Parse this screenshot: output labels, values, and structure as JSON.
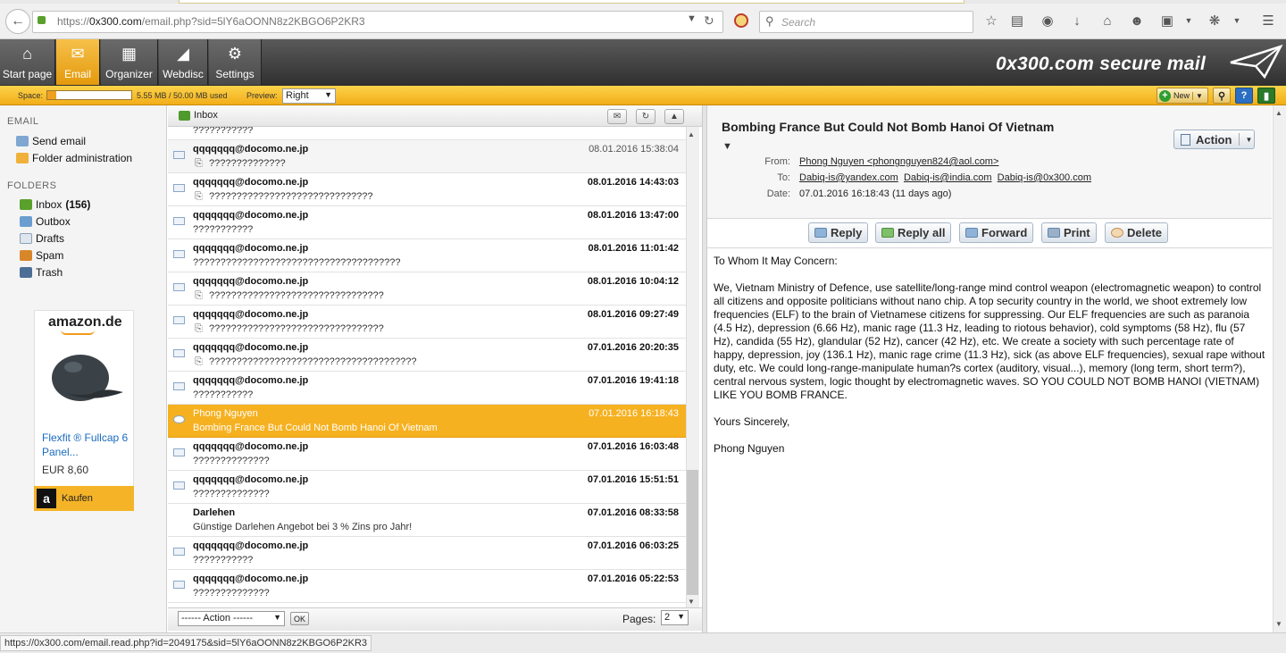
{
  "browser": {
    "url_prefix": "https://",
    "url_domain": "0x300.com",
    "url_rest": "/email.php?sid=5lY6aOONN8z2KBGO6P2KR3",
    "search_placeholder": "Search"
  },
  "app": {
    "nav": [
      {
        "label": "Start page",
        "icon": "home-icon"
      },
      {
        "label": "Email",
        "icon": "envelope-icon"
      },
      {
        "label": "Organizer",
        "icon": "calendar-icon"
      },
      {
        "label": "Webdisc",
        "icon": "folder-icon"
      },
      {
        "label": "Settings",
        "icon": "gear-icon"
      }
    ],
    "brand": "0x300.com secure mail",
    "space_label": "Space:",
    "space_text": "5.55 MB / 50.00 MB used",
    "space_used_fraction": 0.111,
    "preview_label": "Preview:",
    "preview_value": "Right",
    "new_label": "New"
  },
  "sidebar": {
    "email_section": "EMAIL",
    "send_email": "Send email",
    "folder_admin": "Folder administration",
    "folders_section": "FOLDERS",
    "folders": [
      {
        "label": "Inbox",
        "count": "(156)"
      },
      {
        "label": "Outbox",
        "count": ""
      },
      {
        "label": "Drafts",
        "count": ""
      },
      {
        "label": "Spam",
        "count": ""
      },
      {
        "label": "Trash",
        "count": ""
      }
    ],
    "ad": {
      "logo": "amazon.de",
      "title": "Flexfit ® Fullcap 6 Panel...",
      "price": "EUR 8,60",
      "buy": "Kaufen"
    }
  },
  "list": {
    "header": "Inbox",
    "partial_subject": "???????????",
    "rows": [
      {
        "from": "qqqqqqq@docomo.ne.jp",
        "date": "08.01.2016 15:38:04",
        "subject": "??????????????",
        "attach": true,
        "read": true
      },
      {
        "from": "qqqqqqq@docomo.ne.jp",
        "date": "08.01.2016 14:43:03",
        "subject": "??????????????????????????????",
        "attach": true,
        "read": false
      },
      {
        "from": "qqqqqqq@docomo.ne.jp",
        "date": "08.01.2016 13:47:00",
        "subject": "???????????",
        "attach": false,
        "read": false
      },
      {
        "from": "qqqqqqq@docomo.ne.jp",
        "date": "08.01.2016 11:01:42",
        "subject": "??????????????????????????????????????",
        "attach": false,
        "read": false
      },
      {
        "from": "qqqqqqq@docomo.ne.jp",
        "date": "08.01.2016 10:04:12",
        "subject": "????????????????????????????????",
        "attach": true,
        "read": false
      },
      {
        "from": "qqqqqqq@docomo.ne.jp",
        "date": "08.01.2016 09:27:49",
        "subject": "????????????????????????????????",
        "attach": true,
        "read": false
      },
      {
        "from": "qqqqqqq@docomo.ne.jp",
        "date": "07.01.2016 20:20:35",
        "subject": "??????????????????????????????????????",
        "attach": true,
        "read": false
      },
      {
        "from": "qqqqqqq@docomo.ne.jp",
        "date": "07.01.2016 19:41:18",
        "subject": "???????????",
        "attach": false,
        "read": false
      },
      {
        "from": "Phong Nguyen",
        "date": "07.01.2016 16:18:43",
        "subject": "Bombing France But Could Not Bomb Hanoi Of Vietnam",
        "attach": false,
        "read": true,
        "selected": true
      },
      {
        "from": "qqqqqqq@docomo.ne.jp",
        "date": "07.01.2016 16:03:48",
        "subject": "??????????????",
        "attach": false,
        "read": false
      },
      {
        "from": "qqqqqqq@docomo.ne.jp",
        "date": "07.01.2016 15:51:51",
        "subject": "??????????????",
        "attach": false,
        "read": false
      },
      {
        "from": "Darlehen",
        "date": "07.01.2016 08:33:58",
        "subject": "Günstige Darlehen Angebot bei 3 % Zins pro Jahr!",
        "attach": false,
        "read": false,
        "noicon": true
      },
      {
        "from": "qqqqqqq@docomo.ne.jp",
        "date": "07.01.2016 06:03:25",
        "subject": "???????????",
        "attach": false,
        "read": false
      },
      {
        "from": "qqqqqqq@docomo.ne.jp",
        "date": "07.01.2016 05:22:53",
        "subject": "??????????????",
        "attach": false,
        "read": false
      }
    ],
    "action_select": "------ Action ------",
    "ok": "OK",
    "pages_label": "Pages:",
    "page_value": "2"
  },
  "message": {
    "subject": "Bombing France But Could Not Bomb Hanoi Of Vietnam",
    "from_label": "From:",
    "from": "Phong Nguyen <phongnguyen824@aol.com>",
    "to_label": "To:",
    "to": [
      "Dabiq-is@yandex.com",
      "Dabiq-is@india.com",
      "Dabiq-is@0x300.com"
    ],
    "date_label": "Date:",
    "date": "07.01.2016 16:18:43 (11 days ago)",
    "action": "Action",
    "buttons": [
      "Reply",
      "Reply all",
      "Forward",
      "Print",
      "Delete"
    ],
    "body": [
      "To Whom It May Concern:",
      "We, Vietnam Ministry of Defence, use satellite/long-range mind control weapon (electromagnetic weapon) to control all citizens and opposite politicians without nano chip. A top security country in the world, we shoot extremely low frequencies (ELF) to the brain of Vietnamese citizens for suppressing. Our ELF frequencies are such as paranoia (4.5 Hz), depression (6.66 Hz), manic rage (11.3 Hz, leading to riotous behavior), cold symptoms (58 Hz), flu (57 Hz), candida (55 Hz), glandular (52 Hz), cancer (42 Hz), etc. We create a society with such percentage rate of happy, depression, joy (136.1 Hz), manic rage crime (11.3 Hz), sick (as above ELF frequencies), sexual rape without duty, etc. We could long-range-manipulate human?s cortex (auditory, visual...), memory (long term, short term?), central nervous system, logic thought by electromagnetic waves. SO YOU COULD NOT BOMB HANOI (VIETNAM) LIKE YOU BOMB FRANCE.",
      "Yours Sincerely,",
      "Phong Nguyen"
    ]
  },
  "status_url": "https://0x300.com/email.read.php?id=2049175&sid=5lY6aOONN8z2KBGO6P2KR3"
}
